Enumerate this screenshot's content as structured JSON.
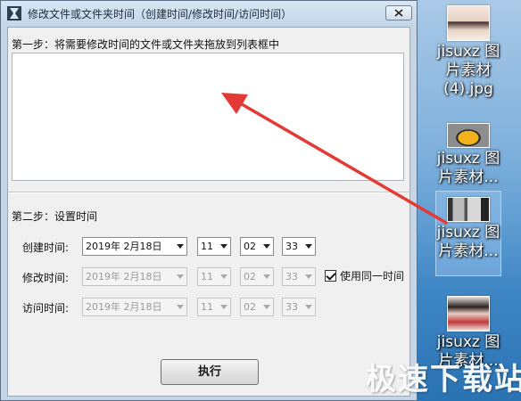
{
  "window": {
    "title": "修改文件或文件夹时间（创建时间/修改时间/访问时间）"
  },
  "step1": {
    "label": "第一步：将需要修改时间的文件或文件夹拖放到列表框中"
  },
  "step2": {
    "label": "第二步：设置时间",
    "rows": [
      {
        "label": "创建时间:",
        "date": "2019年  2月18日",
        "hour": "11",
        "minute": "02",
        "second": "33",
        "enabled": true
      },
      {
        "label": "修改时间:",
        "date": "2019年  2月18日",
        "hour": "11",
        "minute": "02",
        "second": "33",
        "enabled": false
      },
      {
        "label": "访问时间:",
        "date": "2019年  2月18日",
        "hour": "11",
        "minute": "02",
        "second": "33",
        "enabled": false
      }
    ],
    "same_time": {
      "label": "使用同一时间",
      "checked": true
    }
  },
  "buttons": {
    "execute": "执行"
  },
  "desktop_icons": [
    {
      "label": "jisuxz 图片素材(4).jpg",
      "icon": "image-thumbnail-icon"
    },
    {
      "label": "jisuxz 图片素材...",
      "icon": "image-thumbnail-icon"
    },
    {
      "label": "jisuxz 图片素材...",
      "icon": "image-thumbnail-icon"
    },
    {
      "label": "jisuxz 图片素材...",
      "icon": "image-thumbnail-icon"
    }
  ],
  "watermark": "极速下载站",
  "colors": {
    "annotation_arrow": "#e53935",
    "client_bg": "#f0f0f0",
    "titlebar": "#c3d5e8"
  }
}
